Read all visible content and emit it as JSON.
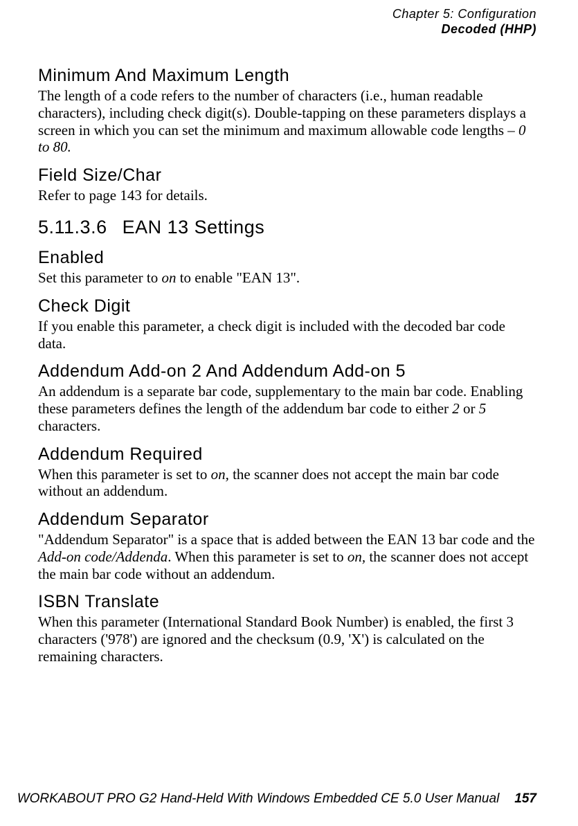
{
  "header": {
    "chapter_line": "Chapter 5: Configuration",
    "section_line": "Decoded (HHP)"
  },
  "sections": {
    "minmax": {
      "title": "Minimum And Maximum Length",
      "body_a": "The length of a code refers to the number of characters (i.e., human readable characters), including check digit(s). Double-tapping on these parameters displays a screen in which you can set the minimum and maximum allowable code lengths – ",
      "body_ital": "0 to 80.",
      "body_b": ""
    },
    "fieldsize": {
      "title": "Field Size/Char",
      "body": "Refer to page 143 for details."
    },
    "ean13_heading": {
      "num": "5.11.3.6",
      "title": "EAN 13 Settings"
    },
    "enabled": {
      "title": "Enabled",
      "body_a": "Set this parameter to ",
      "body_ital": "on",
      "body_b": " to enable \"EAN 13\"."
    },
    "checkdigit": {
      "title": "Check Digit",
      "body": "If you enable this parameter, a check digit is included with the decoded bar code data."
    },
    "addendum25": {
      "title": "Addendum Add-on 2 And Addendum Add-on 5",
      "body_a": "An addendum is a separate bar code, supplementary to the main bar code. Enabling these parameters defines the length of the addendum bar code to either ",
      "body_ital1": "2",
      "body_mid": " or ",
      "body_ital2": "5",
      "body_b": " characters."
    },
    "addreq": {
      "title": "Addendum Required",
      "body_a": "When this parameter is set to ",
      "body_ital": "on,",
      "body_b": " the scanner does not accept the main bar code without an addendum."
    },
    "addsep": {
      "title": "Addendum Separator",
      "body_a": "\"Addendum Separator\" is a space that is added between the EAN 13 bar code and the ",
      "body_ital1": "Add-on code/Addenda",
      "body_mid": ". When this parameter is set to ",
      "body_ital2": "on,",
      "body_b": " the scanner does not accept the main bar code without an addendum."
    },
    "isbn": {
      "title": "ISBN Translate",
      "body": "When this parameter (International Standard Book Number) is enabled, the first 3 characters ('978') are ignored and the checksum (0.9, 'X') is calculated on the remaining characters."
    }
  },
  "footer": {
    "text": "WORKABOUT PRO G2 Hand-Held With Windows Embedded CE 5.0 User Manual",
    "page": "157"
  }
}
